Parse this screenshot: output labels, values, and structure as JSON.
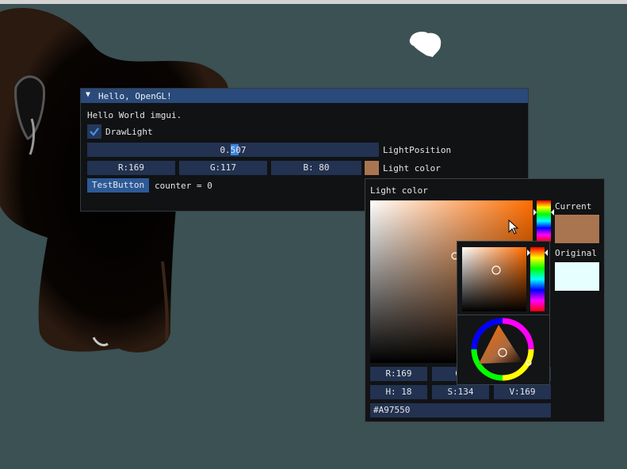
{
  "window": {
    "title": "Hello, OpenGL!",
    "hello_text": "Hello World imgui.",
    "draw_light_label": "DrawLight",
    "draw_light_checked": true,
    "light_position_value": "0.507",
    "light_position_label": "LightPosition",
    "color_r": "R:169",
    "color_g": "G:117",
    "color_b": "B: 80",
    "light_color_label": "Light color",
    "test_button_label": "TestButton",
    "counter_text": "counter = 0"
  },
  "picker": {
    "title": "Light color",
    "r": "R:169",
    "g": "G:",
    "b": "B:",
    "h": "H: 18",
    "s": "S:134",
    "v": "V:169",
    "hex": "#A97550",
    "current_label": "Current",
    "original_label": "Original"
  },
  "colors": {
    "current": "#a97550",
    "original": "#e6ffff",
    "title_bar": "#294a7a",
    "frame_bg": "#223250",
    "button": "#2c5a97"
  },
  "icons": [
    "collapse-arrow-icon",
    "checkmark-icon",
    "mouse-cursor-icon"
  ]
}
